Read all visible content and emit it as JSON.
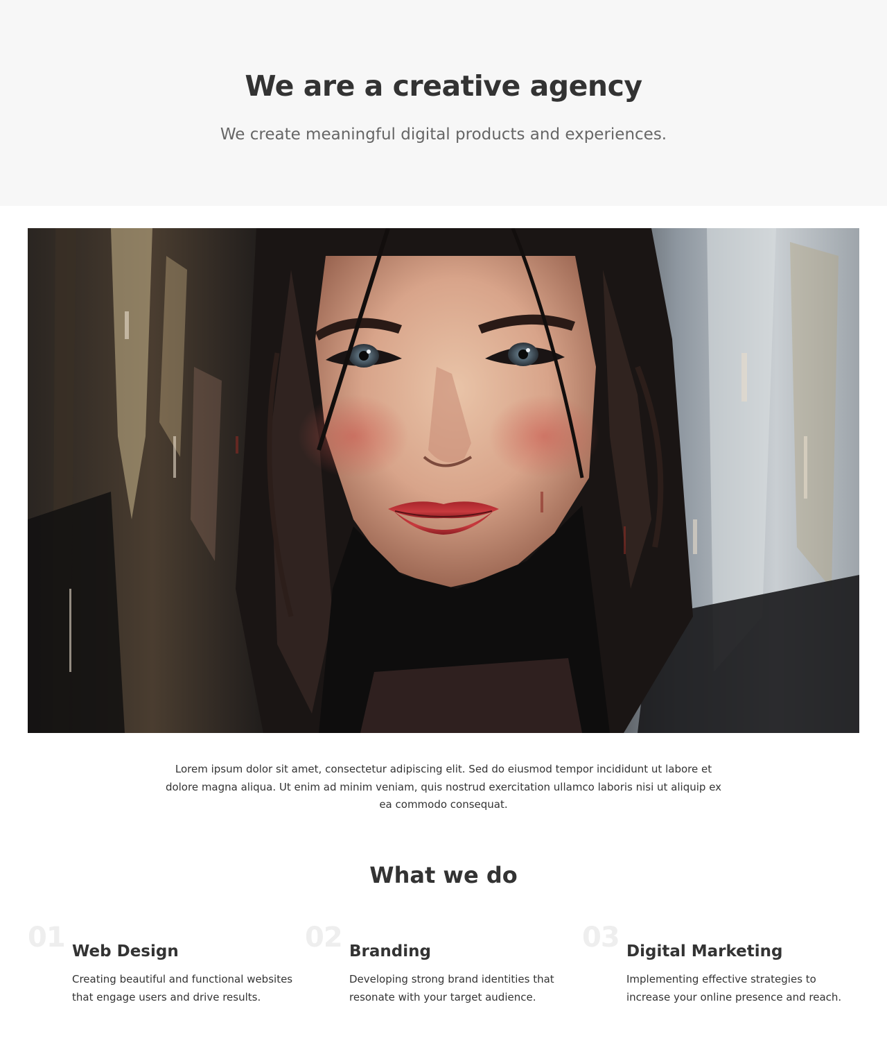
{
  "hero": {
    "title": "We are a creative agency",
    "subtitle": "We create meaningful digital products and experiences."
  },
  "intro": {
    "text": "Lorem ipsum dolor sit amet, consectetur adipiscing elit. Sed do eiusmod tempor incididunt ut labore et dolore magna aliqua. Ut enim ad minim veniam, quis nostrud exercitation ullamco laboris nisi ut aliquip ex ea commodo consequat."
  },
  "services": {
    "title": "What we do",
    "items": [
      {
        "number": "01",
        "title": "Web Design",
        "description": "Creating beautiful and functional websites that engage users and drive results."
      },
      {
        "number": "02",
        "title": "Branding",
        "description": "Developing strong brand identities that resonate with your target audience."
      },
      {
        "number": "03",
        "title": "Digital Marketing",
        "description": "Implementing effective strategies to increase your online presence and reach."
      }
    ]
  },
  "colors": {
    "hero_background": "#f7f7f7",
    "text": "#333333",
    "subtitle": "#666666",
    "number_watermark": "#eeeeee"
  }
}
